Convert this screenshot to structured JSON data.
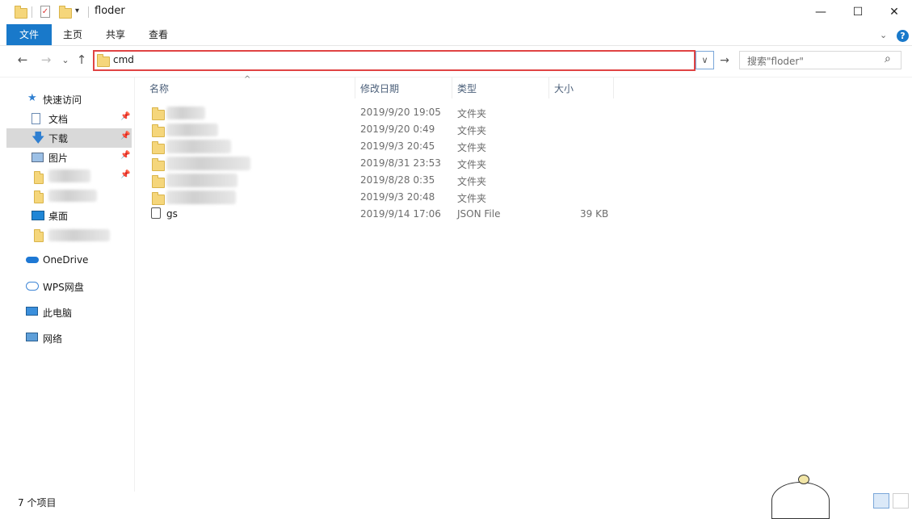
{
  "window": {
    "title": "floder",
    "buttons": {
      "minimize": "—",
      "maximize": "☐",
      "close": "✕"
    }
  },
  "ribbon": {
    "tabs": [
      "文件",
      "主页",
      "共享",
      "查看"
    ],
    "active_tab": "文件",
    "help": "?"
  },
  "navigation": {
    "back": "←",
    "forward": "→",
    "recent": "⌄",
    "up": "↑",
    "address_value": "cmd",
    "address_dropdown": "∨",
    "go": "→",
    "search_placeholder": "搜索\"floder\"",
    "search_icon": "⌕"
  },
  "sidebar": {
    "quick_access": "快速访问",
    "items": [
      {
        "label": "文档",
        "icon": "document-icon",
        "pinned": true
      },
      {
        "label": "下载",
        "icon": "download-icon",
        "pinned": true,
        "selected": true
      },
      {
        "label": "图片",
        "icon": "picture-icon",
        "pinned": true
      },
      {
        "label": "",
        "icon": "folder-icon",
        "pinned": true,
        "blurred": true
      },
      {
        "label": "",
        "icon": "folder-icon",
        "pinned": false,
        "blurred": true
      },
      {
        "label": "桌面",
        "icon": "desktop-icon",
        "pinned": false
      },
      {
        "label": "",
        "icon": "folder-icon",
        "pinned": false,
        "blurred": true
      }
    ],
    "onedrive": "OneDrive",
    "wps": "WPS网盘",
    "this_pc": "此电脑",
    "network": "网络",
    "pin_glyph": "📌"
  },
  "columns": {
    "name": "名称",
    "date": "修改日期",
    "type": "类型",
    "size": "大小"
  },
  "files": [
    {
      "name": "",
      "date": "2019/9/20 19:05",
      "type": "文件夹",
      "size": "",
      "kind": "folder"
    },
    {
      "name": "",
      "date": "2019/9/20 0:49",
      "type": "文件夹",
      "size": "",
      "kind": "folder"
    },
    {
      "name": "",
      "date": "2019/9/3 20:45",
      "type": "文件夹",
      "size": "",
      "kind": "folder"
    },
    {
      "name": "",
      "date": "2019/8/31 23:53",
      "type": "文件夹",
      "size": "",
      "kind": "folder"
    },
    {
      "name": "",
      "date": "2019/8/28 0:35",
      "type": "文件夹",
      "size": "",
      "kind": "folder"
    },
    {
      "name": "",
      "date": "2019/9/3 20:48",
      "type": "文件夹",
      "size": "",
      "kind": "folder"
    },
    {
      "name": "gs",
      "date": "2019/9/14 17:06",
      "type": "JSON File",
      "size": "39 KB",
      "kind": "file"
    }
  ],
  "status_bar": {
    "count": "7 个项目"
  },
  "colors": {
    "accent": "#1979ca",
    "highlight_border": "#e04343",
    "folder": "#f5d67b"
  }
}
